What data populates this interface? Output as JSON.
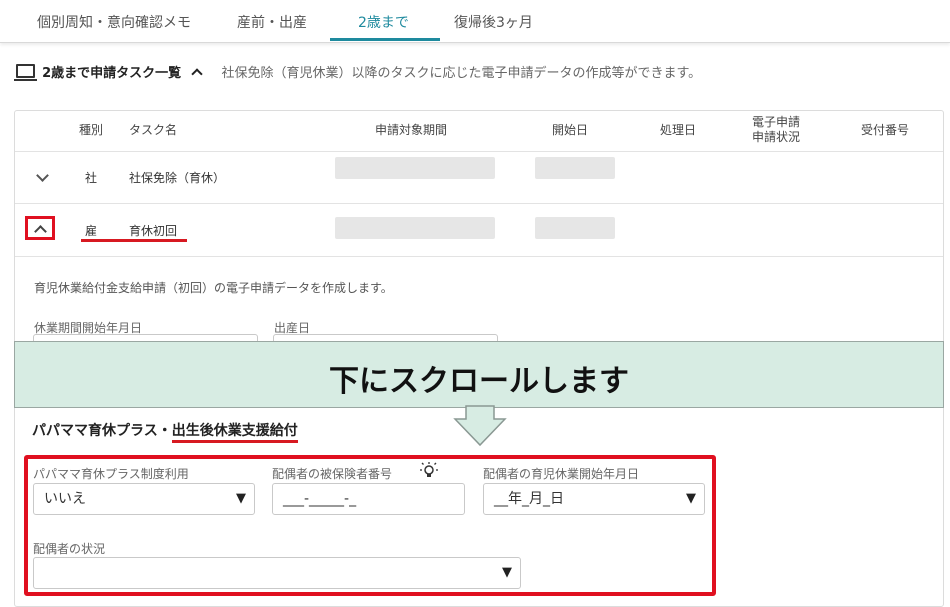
{
  "tabs": [
    {
      "label": "個別周知・意向確認メモ"
    },
    {
      "label": "産前・出産"
    },
    {
      "label": "2歳まで"
    },
    {
      "label": "復帰後3ヶ月"
    }
  ],
  "section": {
    "title": "2歳まで申請タスク一覧",
    "description": "社保免除（育児休業）以降のタスクに応じた電子申請データの作成等ができます。"
  },
  "table": {
    "headers": {
      "type": "種別",
      "task": "タスク名",
      "period": "申請対象期間",
      "start": "開始日",
      "processed": "処理日",
      "status_line1": "電子申請",
      "status_line2": "申請状況",
      "receipt": "受付番号"
    },
    "rows": [
      {
        "type": "社",
        "task": "社保免除（育休）"
      },
      {
        "type": "雇",
        "task": "育休初回"
      }
    ]
  },
  "detail": {
    "description": "育児休業給付金支給申請（初回）の電子申請データを作成します。",
    "leave_start_label": "休業期間開始年月日",
    "birth_date_label": "出産日"
  },
  "banner": {
    "text": "下にスクロールします"
  },
  "papa": {
    "title_plain": "パパママ育休プラス・",
    "title_underlined": "出生後休業支援給付",
    "plus_label": "パパママ育休プラス制度利用",
    "plus_value": "いいえ",
    "spouse_insured_label": "配偶者の被保険者番号",
    "spouse_insured_placeholder": "___-_____-_",
    "spouse_leave_label": "配偶者の育児休業開始年月日",
    "spouse_leave_placeholder": "__年_月_日",
    "spouse_status_label": "配偶者の状況",
    "spouse_status_value": ""
  },
  "colors": {
    "accent": "#1e8a9e",
    "highlight_red": "#e01020",
    "banner_bg": "#d7ece3"
  },
  "icons": {
    "monitor": "monitor-icon",
    "collapse": "chevron-up-icon",
    "expand": "chevron-down-icon",
    "dropdown": "triangle-down-icon",
    "hint": "lightbulb-icon"
  }
}
